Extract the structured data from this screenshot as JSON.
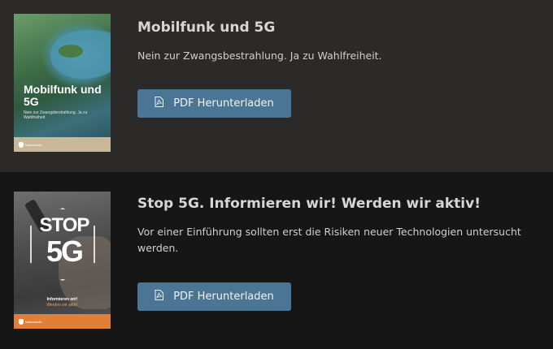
{
  "downloads": [
    {
      "title": "Mobilfunk und 5G",
      "description": "Nein zur Zwangsbestrahlung. Ja zu Wahlfreiheit.",
      "button_label": "PDF Herunterladen",
      "button_icon": "pdf-file-icon",
      "cover": {
        "title": "Mobilfunk und 5G",
        "subtitle": "Nein zur Zwangsbestrahlung. Ja zu Wahlfreiheit",
        "publisher": "Naturwacht",
        "footer_color": "#c7b89a"
      }
    },
    {
      "title": "Stop 5G. Informieren wir! Werden wir aktiv!",
      "description": "Vor einer Einführung sollten erst die Risiken neuer Technologien untersucht werden.",
      "button_label": "PDF Herunterladen",
      "button_icon": "pdf-file-icon",
      "cover": {
        "headline_top": "STOP",
        "headline_bottom": "5G",
        "line1": "Informieren wir!",
        "line2": "Werden wir aktiv!",
        "publisher": "Naturwacht",
        "footer_color": "#e07f35"
      }
    }
  ],
  "colors": {
    "row_background_1": "#2b2a28",
    "row_background_2": "#161616",
    "button_background": "#4b7594"
  }
}
